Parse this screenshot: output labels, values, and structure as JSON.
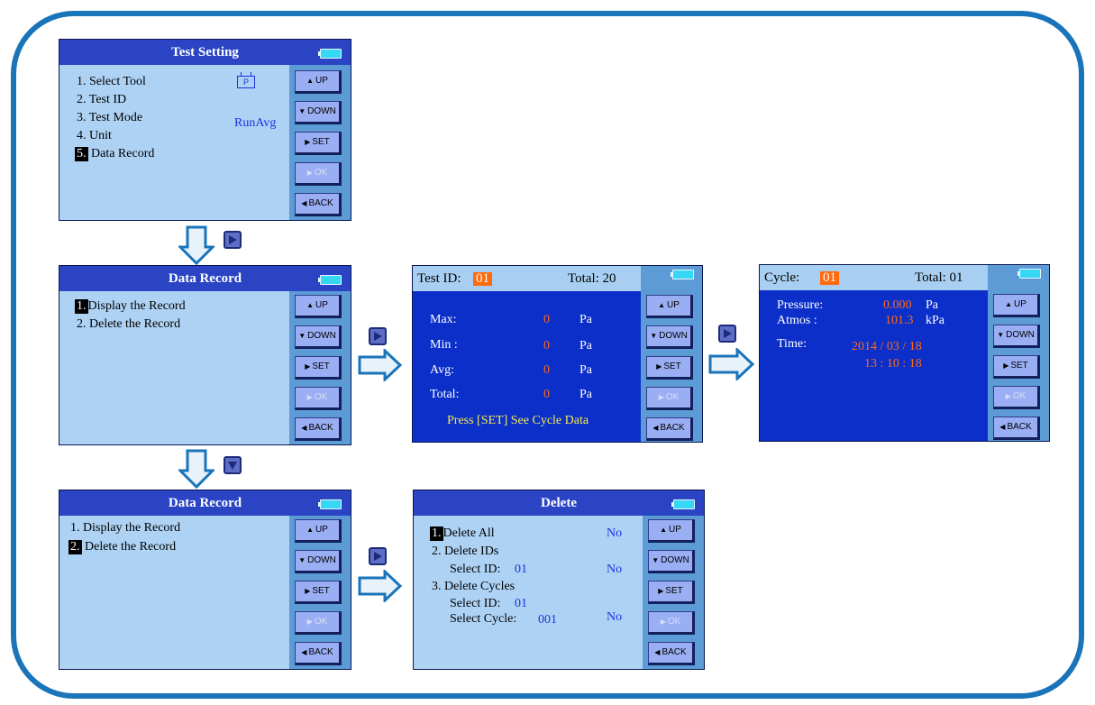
{
  "colors": {
    "frame": "#1a74b9",
    "title_bar": "#2a44c4",
    "light_screen": "#aed2f4",
    "dark_screen": "#0b2fc8",
    "sidebar": "#5c9bd5",
    "button": "#9aaef4",
    "highlight": "#ff6a0c",
    "arrow": "#1a74b9"
  },
  "buttons": {
    "up": "UP",
    "down": "DOWN",
    "set": "SET",
    "ok": "OK",
    "back": "BACK"
  },
  "icons": {
    "battery": "battery-icon",
    "tool": "pressure-tool-icon",
    "nav_right": "right-key-icon",
    "nav_down": "down-key-icon",
    "flow": "flow-arrow-icon"
  },
  "test_setting": {
    "title": "Test Setting",
    "items": [
      "1. Select Tool",
      "2. Test ID",
      "3. Test Mode",
      "4. Unit"
    ],
    "item5_num": "5.",
    "item5_label": "Data Record",
    "tool_value": "P",
    "mode_value": "RunAvg"
  },
  "data_record_1": {
    "title": "Data Record",
    "item1_num": "1.",
    "item1_label": "Display the Record",
    "item2": "2.  Delete the Record"
  },
  "data_record_2": {
    "title": "Data Record",
    "item1": "1.  Display the Record",
    "item2_num": "2.",
    "item2_label": "Delete the Record"
  },
  "test_id_screen": {
    "id_label": "Test ID:",
    "id_value": "01",
    "total_label": "Total: 20",
    "rows": [
      {
        "label": "Max:",
        "value": "0",
        "unit": "Pa"
      },
      {
        "label": "Min :",
        "value": "0",
        "unit": "Pa"
      },
      {
        "label": "Avg:",
        "value": "0",
        "unit": "Pa"
      },
      {
        "label": "Total:",
        "value": "0",
        "unit": "Pa"
      }
    ],
    "hint": "Press [SET] See Cycle Data"
  },
  "cycle_screen": {
    "cycle_label": "Cycle:",
    "cycle_value": "01",
    "total_label": "Total: 01",
    "pressure_label": "Pressure:",
    "pressure_value": "0.000",
    "pressure_unit": "Pa",
    "atmos_label": "Atmos :",
    "atmos_value": "101.3",
    "atmos_unit": "kPa",
    "time_label": "Time:",
    "date_value": "2014 / 03 / 18",
    "time_value": "13 : 10 : 18"
  },
  "delete_screen": {
    "title": "Delete",
    "item1_num": "1.",
    "item1_label": "Delete All",
    "item1_value": "No",
    "item2": "2.  Delete IDs",
    "item2_sub_label": "Select ID:",
    "item2_sub_value": "01",
    "item2_value": "No",
    "item3": "3.  Delete Cycles",
    "item3_sub1_label": "Select ID:",
    "item3_sub1_value": "01",
    "item3_sub2_label": "Select Cycle:",
    "item3_sub2_value": "001",
    "item3_value": "No"
  }
}
